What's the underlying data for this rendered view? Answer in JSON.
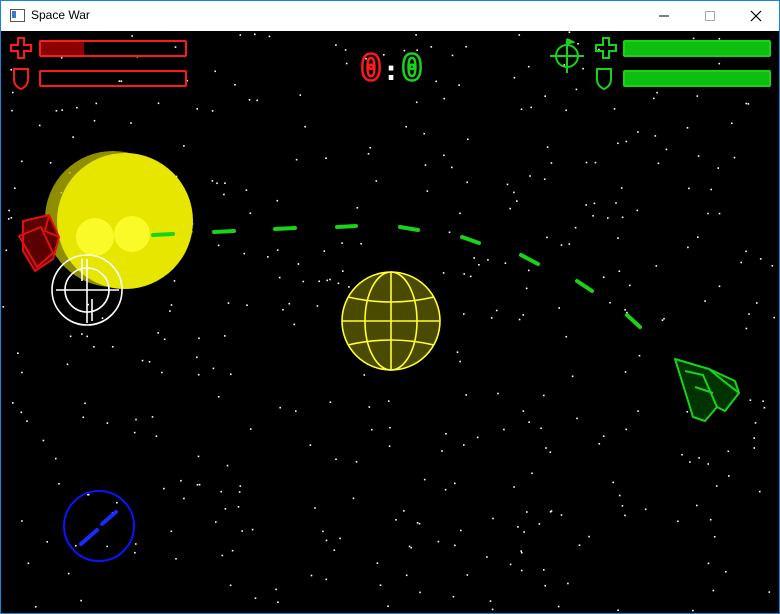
{
  "window": {
    "title": "Space War",
    "controls": [
      "minimize",
      "maximize",
      "close"
    ]
  },
  "hud": {
    "score": {
      "red": "0",
      "separator": ":",
      "green": "0"
    },
    "red_player": {
      "color": "#ff1a1a",
      "health_fraction": 0.3,
      "shield_fraction": 0.0,
      "icons": [
        "health-cross-icon",
        "shield-icon"
      ]
    },
    "green_player": {
      "color": "#18d418",
      "health_fraction": 1.0,
      "shield_fraction": 1.0,
      "icons": [
        "crosshair-icon",
        "health-cross-icon",
        "shield-icon"
      ]
    }
  },
  "scene": {
    "background": "#000000",
    "sun_color": "#e6e600",
    "planet_color": "#e6e600",
    "missile_color": "#18d418",
    "objects": [
      "yellow-sun",
      "wireframe-planet",
      "red-ship",
      "green-ship",
      "white-crosshair",
      "blue-wormhole",
      "green-missile-trail"
    ]
  }
}
